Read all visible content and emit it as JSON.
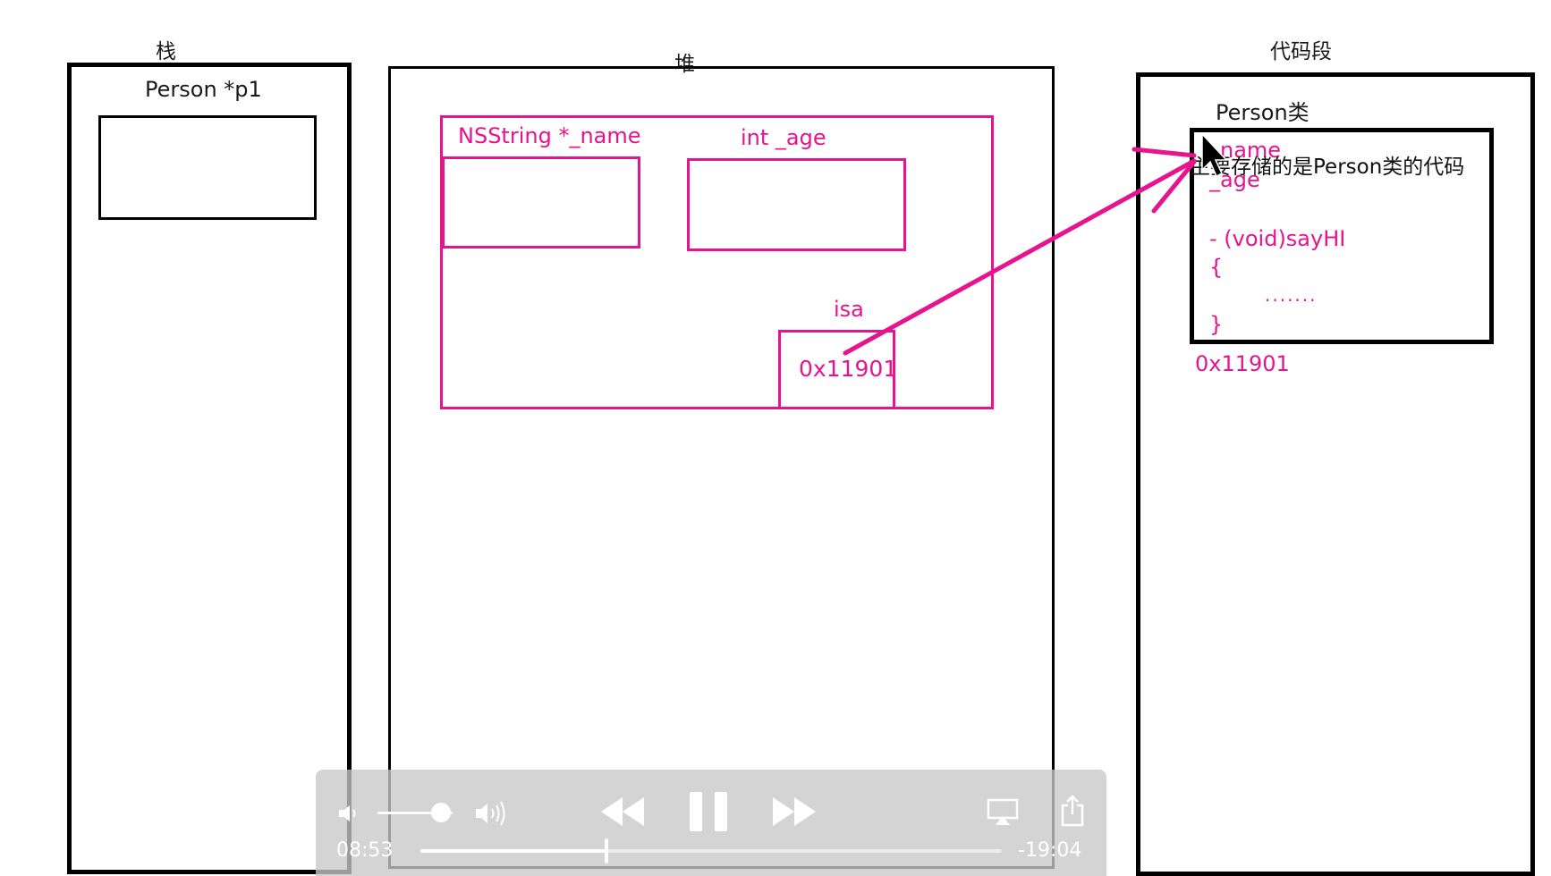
{
  "stack": {
    "title": "栈",
    "var_label": "Person *p1"
  },
  "heap": {
    "title": "堆",
    "field_name_label": "NSString *_name",
    "field_age_label": "int _age",
    "isa_label": "isa",
    "isa_value": "0x11901"
  },
  "code_segment": {
    "title": "代码段",
    "class_label": "Person类",
    "members": {
      "name": "_name",
      "age": "_age",
      "method": "- (void)sayHI",
      "open_brace": "{",
      "body": ".......",
      "close_brace": "}"
    },
    "address": "0x11901",
    "annotation": "主要存储的是Person类的代码"
  },
  "player": {
    "elapsed": "08:53",
    "remaining": "-19:04",
    "progress": 0.32,
    "volume": 0.85,
    "icons": {
      "volume_low": "speaker-low-icon",
      "volume_high": "speaker-high-icon",
      "rewind": "rewind-icon",
      "pause": "pause-icon",
      "fast_forward": "fast-forward-icon",
      "airplay": "airplay-icon",
      "share": "share-icon"
    }
  },
  "colors": {
    "accent": "#e6148f",
    "line": "#000000"
  }
}
